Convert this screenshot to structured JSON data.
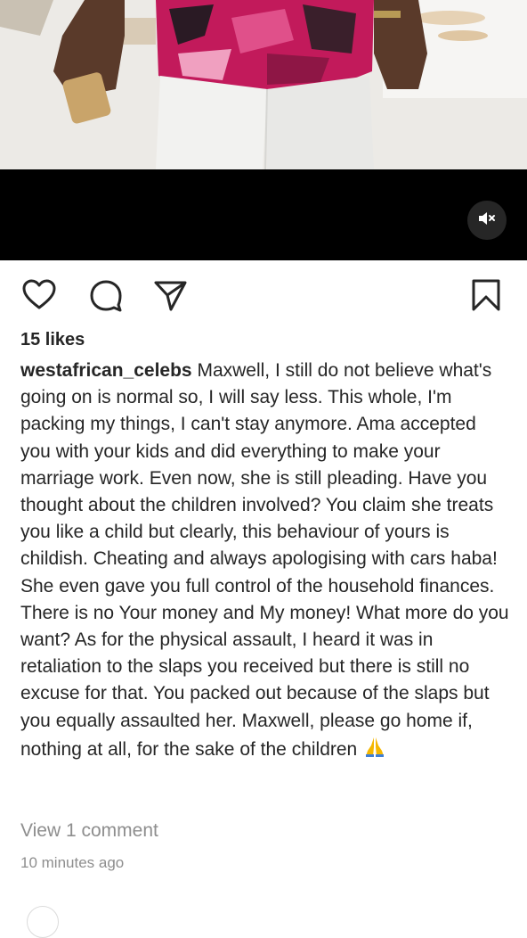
{
  "post": {
    "likes": "15 likes",
    "username": "westafrican_celebs",
    "caption_text": "Maxwell, I still do not believe what's going on is normal so, I will say less. This whole, I'm packing my things, I can't stay anymore. Ama accepted you with your kids and did everything to make your marriage work. Even now, she is still pleading. Have you thought about the children involved? You claim she treats you like a child but clearly, this behaviour of yours is childish. Cheating and always apologising with cars haba! She even gave you full control of the household finances. There is no Your money and My money! What more do you want? As for the physical assault, I heard it was in retaliation to the slaps you received but there is still no excuse for that. You packed out because of the slaps but you equally assaulted her. Maxwell, please go home if, nothing at all, for the sake of the children",
    "caption_emoji": "folded-hands-emoji",
    "view_comments": "View 1 comment",
    "timestamp": "10 minutes ago"
  },
  "icons": {
    "like": "heart-icon",
    "comment": "comment-bubble-icon",
    "share": "paper-plane-icon",
    "save": "bookmark-icon",
    "mute": "speaker-muted-icon"
  },
  "colors": {
    "text": "#262626",
    "secondary_text": "#8e8e8e",
    "media_background": "#000000"
  }
}
